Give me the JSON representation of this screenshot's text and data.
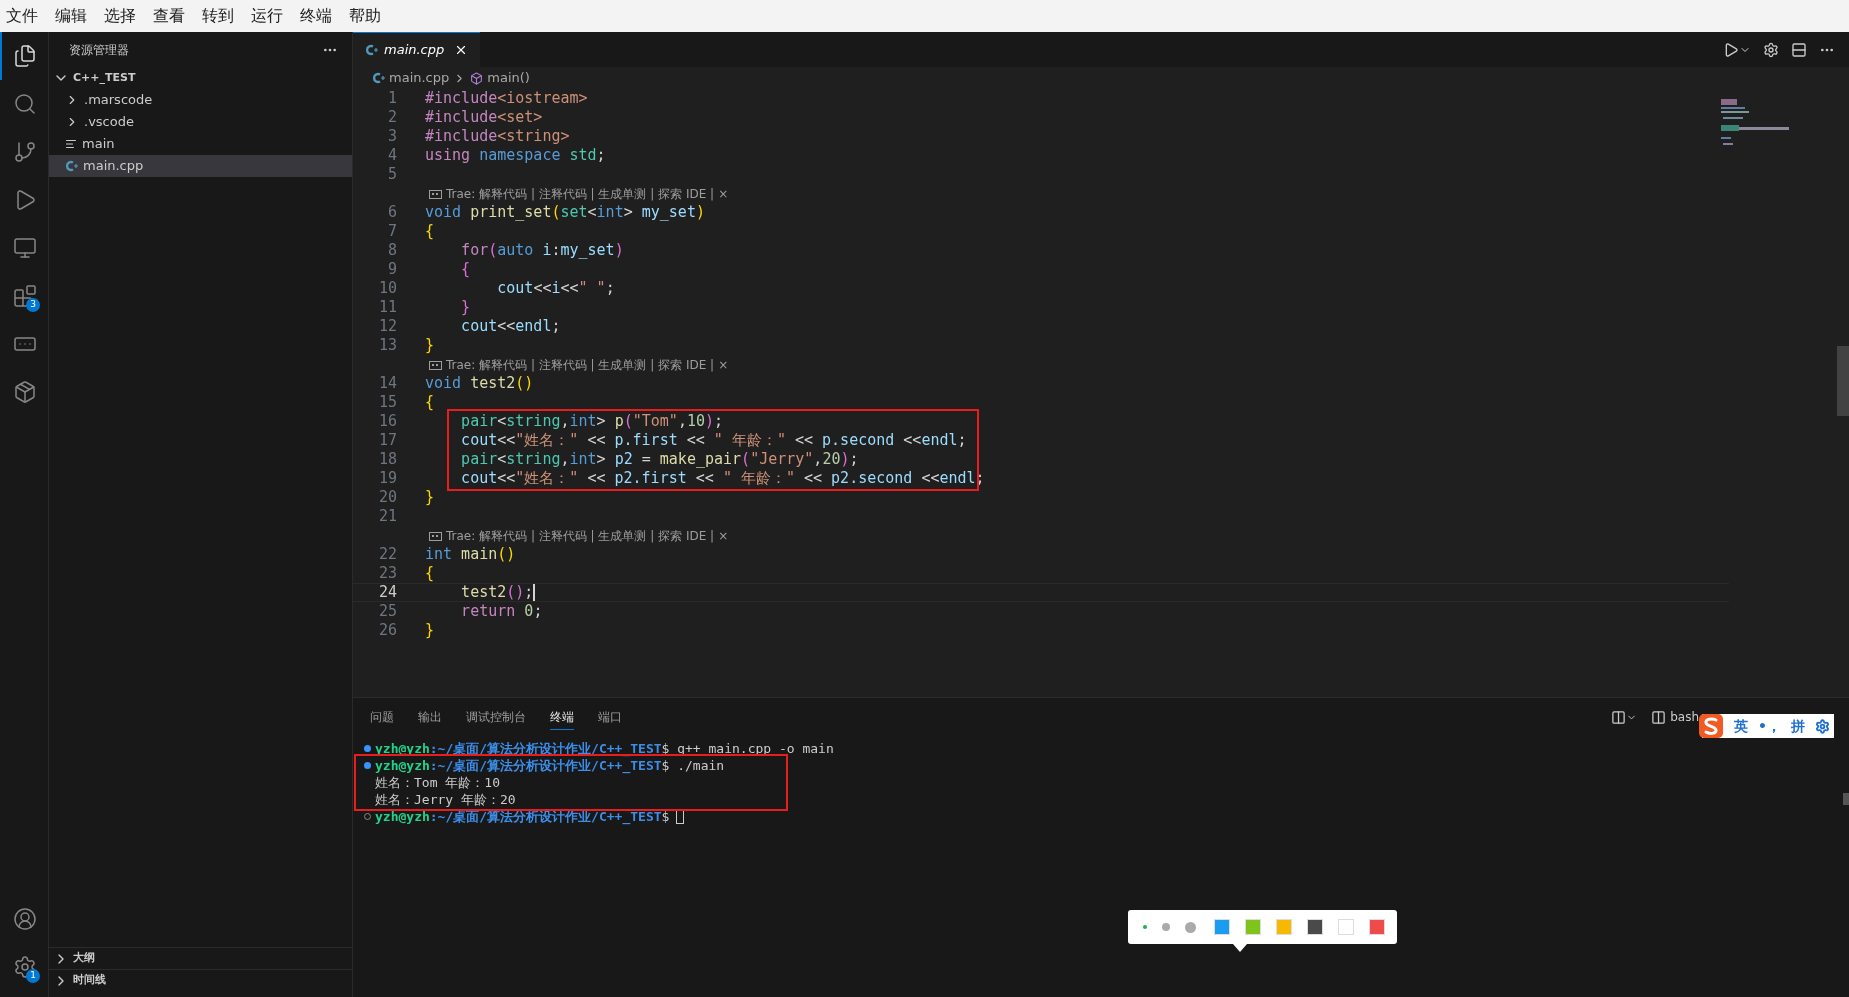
{
  "menu_bar": {
    "items": [
      "文件",
      "编辑",
      "选择",
      "查看",
      "转到",
      "运行",
      "终端",
      "帮助"
    ]
  },
  "activity_bar": {
    "items": [
      {
        "selected": true
      },
      {
        "selected": false
      },
      {
        "selected": false
      },
      {
        "selected": false
      },
      {
        "selected": false
      },
      {
        "selected": false,
        "badge": "3"
      },
      {
        "selected": false
      },
      {
        "selected": false
      }
    ],
    "bottom": [
      {
        "selected": false
      },
      {
        "selected": false,
        "badge": "1"
      }
    ]
  },
  "sidebar": {
    "title": "资源管理器",
    "tree": {
      "label": "C++_TEST",
      "expanded": true,
      "children": [
        {
          "label": ".marscode",
          "kind": "folder",
          "expanded": false,
          "selected": false
        },
        {
          "label": ".vscode",
          "kind": "folder",
          "expanded": false,
          "selected": false
        },
        {
          "label": "main",
          "kind": "file",
          "selected": false
        },
        {
          "label": "main.cpp",
          "kind": "cpp",
          "selected": true
        }
      ]
    },
    "sections": [
      {
        "label": "大纲",
        "expanded": false
      },
      {
        "label": "时间线",
        "expanded": false
      }
    ]
  },
  "editor": {
    "tabs": [
      {
        "label": "main.cpp",
        "selected": true
      }
    ],
    "breadcrumb": [
      "main.cpp",
      "main()"
    ],
    "lines": [
      {
        "kind": "code",
        "number": "1",
        "current": false,
        "tokens": [
          {
            "t": "#include",
            "kind": "kw"
          },
          {
            "t": "<iostream>",
            "kind": "str"
          }
        ]
      },
      {
        "kind": "code",
        "number": "2",
        "current": false,
        "tokens": [
          {
            "t": "#include",
            "kind": "kw"
          },
          {
            "t": "<set>",
            "kind": "str"
          }
        ]
      },
      {
        "kind": "code",
        "number": "3",
        "current": false,
        "tokens": [
          {
            "t": "#include",
            "kind": "kw"
          },
          {
            "t": "<string>",
            "kind": "str"
          }
        ]
      },
      {
        "kind": "code",
        "number": "4",
        "current": false,
        "tokens": [
          {
            "t": "using",
            "kind": "kw"
          },
          {
            "t": " namespace",
            "kind": "ty"
          },
          {
            "t": " std",
            "kind": "cls"
          },
          {
            "t": ";",
            "kind": "p"
          }
        ]
      },
      {
        "kind": "code",
        "number": "5",
        "current": false
      },
      {
        "kind": "lens",
        "text": "Trae: 解释代码 | 注释代码 | 生成单测 | 探索 IDE |",
        "close": "×"
      },
      {
        "kind": "code",
        "number": "6",
        "current": false,
        "tokens": [
          {
            "t": "void",
            "kind": "ty"
          },
          {
            "t": " print_set",
            "kind": "fn"
          },
          {
            "t": "(",
            "kind": "b1"
          },
          {
            "t": "set",
            "kind": "cls"
          },
          {
            "t": "<",
            "kind": "p"
          },
          {
            "t": "int",
            "kind": "ty"
          },
          {
            "t": "> ",
            "kind": "p"
          },
          {
            "t": "my_set",
            "kind": "var"
          },
          {
            "t": ")",
            "kind": "b1"
          }
        ]
      },
      {
        "kind": "code",
        "number": "7",
        "current": false,
        "tokens": [
          {
            "t": "{",
            "kind": "b1"
          }
        ]
      },
      {
        "kind": "code",
        "number": "8",
        "current": false,
        "tokens": [
          {
            "t": "    for",
            "kind": "kw"
          },
          {
            "t": "(",
            "kind": "b2"
          },
          {
            "t": "auto",
            "kind": "ty"
          },
          {
            "t": " i",
            "kind": "var"
          },
          {
            "t": ":",
            "kind": "p"
          },
          {
            "t": "my_set",
            "kind": "var"
          },
          {
            "t": ")",
            "kind": "b2"
          }
        ]
      },
      {
        "kind": "code",
        "number": "9",
        "current": false,
        "tokens": [
          {
            "t": "    {",
            "kind": "b2"
          }
        ]
      },
      {
        "kind": "code",
        "number": "10",
        "current": false,
        "tokens": [
          {
            "t": "        cout",
            "kind": "var"
          },
          {
            "t": "<<",
            "kind": "p"
          },
          {
            "t": "i",
            "kind": "var"
          },
          {
            "t": "<<",
            "kind": "p"
          },
          {
            "t": "\" \"",
            "kind": "str"
          },
          {
            "t": ";",
            "kind": "p"
          }
        ]
      },
      {
        "kind": "code",
        "number": "11",
        "current": false,
        "tokens": [
          {
            "t": "    }",
            "kind": "b2"
          }
        ]
      },
      {
        "kind": "code",
        "number": "12",
        "current": false,
        "tokens": [
          {
            "t": "    cout",
            "kind": "var"
          },
          {
            "t": "<<",
            "kind": "p"
          },
          {
            "t": "endl",
            "kind": "var"
          },
          {
            "t": ";",
            "kind": "p"
          }
        ]
      },
      {
        "kind": "code",
        "number": "13",
        "current": false,
        "tokens": [
          {
            "t": "}",
            "kind": "b1"
          }
        ]
      },
      {
        "kind": "lens",
        "text": "Trae: 解释代码 | 注释代码 | 生成单测 | 探索 IDE |",
        "close": "×"
      },
      {
        "kind": "code",
        "number": "14",
        "current": false,
        "tokens": [
          {
            "t": "void",
            "kind": "ty"
          },
          {
            "t": " test2",
            "kind": "fn"
          },
          {
            "t": "()",
            "kind": "b1"
          }
        ]
      },
      {
        "kind": "code",
        "number": "15",
        "current": false,
        "tokens": [
          {
            "t": "{",
            "kind": "b1"
          }
        ]
      },
      {
        "kind": "box",
        "lines": [
          {
            "kind": "code",
            "number": "16",
            "current": false,
            "tokens": [
              {
                "t": "    pair",
                "kind": "cls"
              },
              {
                "t": "<",
                "kind": "p"
              },
              {
                "t": "string",
                "kind": "cls"
              },
              {
                "t": ",",
                "kind": "p"
              },
              {
                "t": "int",
                "kind": "ty"
              },
              {
                "t": "> ",
                "kind": "p"
              },
              {
                "t": "p",
                "kind": "fn"
              },
              {
                "t": "(",
                "kind": "b2"
              },
              {
                "t": "\"Tom\"",
                "kind": "str"
              },
              {
                "t": ",",
                "kind": "p"
              },
              {
                "t": "10",
                "kind": "num"
              },
              {
                "t": ")",
                "kind": "b2"
              },
              {
                "t": ";",
                "kind": "p"
              }
            ]
          },
          {
            "kind": "code",
            "number": "17",
            "current": false,
            "tokens": [
              {
                "t": "    cout",
                "kind": "var"
              },
              {
                "t": "<<",
                "kind": "p"
              },
              {
                "t": "\"姓名：\"",
                "kind": "str"
              },
              {
                "t": " << ",
                "kind": "p"
              },
              {
                "t": "p.first",
                "kind": "var"
              },
              {
                "t": " << ",
                "kind": "p"
              },
              {
                "t": "\" 年龄：\"",
                "kind": "str"
              },
              {
                "t": " << ",
                "kind": "p"
              },
              {
                "t": "p.second",
                "kind": "var"
              },
              {
                "t": " <<",
                "kind": "p"
              },
              {
                "t": "endl",
                "kind": "var"
              },
              {
                "t": ";",
                "kind": "p"
              }
            ]
          },
          {
            "kind": "code",
            "number": "18",
            "current": false,
            "tokens": [
              {
                "t": "    pair",
                "kind": "cls"
              },
              {
                "t": "<",
                "kind": "p"
              },
              {
                "t": "string",
                "kind": "cls"
              },
              {
                "t": ",",
                "kind": "p"
              },
              {
                "t": "int",
                "kind": "ty"
              },
              {
                "t": "> ",
                "kind": "p"
              },
              {
                "t": "p2",
                "kind": "var"
              },
              {
                "t": " = ",
                "kind": "p"
              },
              {
                "t": "make_pair",
                "kind": "fn"
              },
              {
                "t": "(",
                "kind": "b2"
              },
              {
                "t": "\"Jerry\"",
                "kind": "str"
              },
              {
                "t": ",",
                "kind": "p"
              },
              {
                "t": "20",
                "kind": "num"
              },
              {
                "t": ")",
                "kind": "b2"
              },
              {
                "t": ";",
                "kind": "p"
              }
            ]
          },
          {
            "kind": "code",
            "number": "19",
            "current": false,
            "tokens": [
              {
                "t": "    cout",
                "kind": "var"
              },
              {
                "t": "<<",
                "kind": "p"
              },
              {
                "t": "\"姓名：\"",
                "kind": "str"
              },
              {
                "t": " << ",
                "kind": "p"
              },
              {
                "t": "p2.first",
                "kind": "var"
              },
              {
                "t": " << ",
                "kind": "p"
              },
              {
                "t": "\" 年龄：\"",
                "kind": "str"
              },
              {
                "t": " << ",
                "kind": "p"
              },
              {
                "t": "p2.second",
                "kind": "var"
              },
              {
                "t": " <<",
                "kind": "p"
              },
              {
                "t": "endl",
                "kind": "var"
              },
              {
                "t": ";",
                "kind": "p"
              }
            ]
          }
        ]
      },
      {
        "kind": "code",
        "number": "20",
        "current": false,
        "tokens": [
          {
            "t": "}",
            "kind": "b1"
          }
        ]
      },
      {
        "kind": "code",
        "number": "21",
        "current": false
      },
      {
        "kind": "lens",
        "text": "Trae: 解释代码 | 注释代码 | 生成单测 | 探索 IDE |",
        "close": "×"
      },
      {
        "kind": "code",
        "number": "22",
        "current": false,
        "tokens": [
          {
            "t": "int",
            "kind": "ty"
          },
          {
            "t": " main",
            "kind": "fn"
          },
          {
            "t": "()",
            "kind": "b1"
          }
        ]
      },
      {
        "kind": "code",
        "number": "23",
        "current": false,
        "tokens": [
          {
            "t": "{",
            "kind": "b1"
          }
        ]
      },
      {
        "kind": "code",
        "number": "24",
        "current": true,
        "tokens": [
          {
            "t": "    test2",
            "kind": "fn"
          },
          {
            "t": "()",
            "kind": "b2"
          },
          {
            "t": ";",
            "kind": "p"
          }
        ]
      },
      {
        "kind": "code",
        "number": "25",
        "current": false,
        "tokens": [
          {
            "t": "    return",
            "kind": "kw"
          },
          {
            "t": " 0",
            "kind": "num"
          },
          {
            "t": ";",
            "kind": "p"
          }
        ]
      },
      {
        "kind": "code",
        "number": "26",
        "current": false,
        "tokens": [
          {
            "t": "}",
            "kind": "b1"
          }
        ]
      }
    ]
  },
  "panel": {
    "tabs": [
      {
        "label": "问题",
        "selected": false
      },
      {
        "label": "输出",
        "selected": false
      },
      {
        "label": "调试控制台",
        "selected": false
      },
      {
        "label": "终端",
        "selected": true
      },
      {
        "label": "端口",
        "selected": false
      }
    ],
    "terminal_name": "bash",
    "lines": [
      {
        "kind": "prompt",
        "success": true,
        "user": "yzh@yzh",
        "path": ":~/桌面/算法分析设计作业/C++_TEST",
        "command": "$ g++ main.cpp -o main",
        "cursor": false
      },
      {
        "kind": "box",
        "lines": [
          {
            "kind": "prompt",
            "success": true,
            "user": "yzh@yzh",
            "path": ":~/桌面/算法分析设计作业/C++_TEST",
            "command": "$ ./main",
            "cursor": false
          },
          {
            "kind": "output",
            "text": "姓名：Tom 年龄：10"
          },
          {
            "kind": "output",
            "text": "姓名：Jerry 年龄：20"
          }
        ]
      },
      {
        "kind": "prompt",
        "success": false,
        "user": "yzh@yzh",
        "path": ":~/桌面/算法分析设计作业/C++_TEST",
        "command": "$",
        "cursor": true
      }
    ]
  },
  "ime": {
    "mode": "英",
    "punctuation": "•，",
    "input": "拼"
  },
  "color_toolbar": {
    "sizes": [
      {
        "selected": true
      },
      {
        "selected": false
      },
      {
        "selected": false
      }
    ],
    "swatches": [
      {
        "color": "#1a9cf0"
      },
      {
        "color": "#7ec41b"
      },
      {
        "color": "#f7b900"
      },
      {
        "color": "#4a4a4a"
      },
      {
        "color": "#ffffff"
      },
      {
        "color": "#f04b4b"
      }
    ]
  }
}
